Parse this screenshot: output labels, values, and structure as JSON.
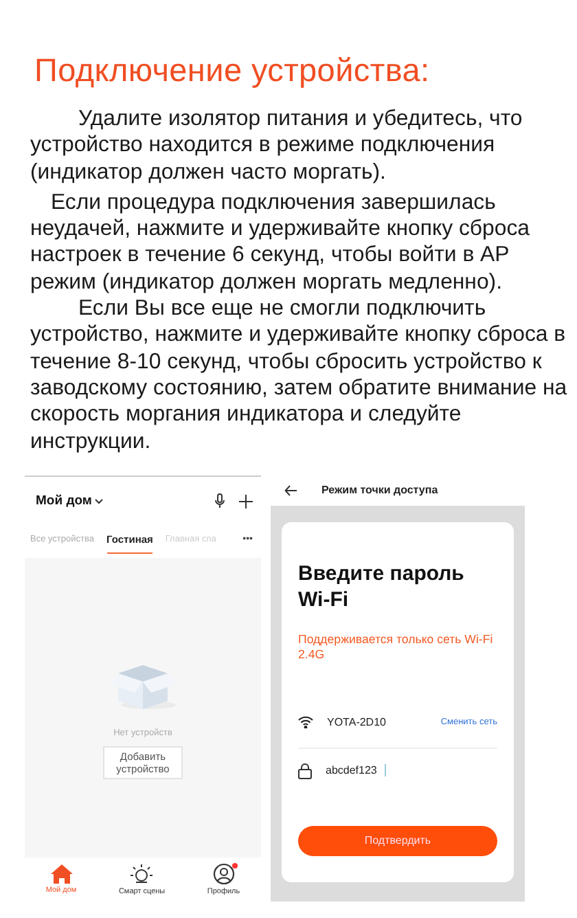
{
  "title": "Подключение устройства:",
  "paragraphs": [
    {
      "text": "Удалите изолятор питания и убедитесь, что устройство находится в режиме подключения (индикатор должен часто моргать).",
      "kind": "deep"
    },
    {
      "text": "Если процедура подключения завершилась неудачей, нажмите и удерживайте кнопку сброса настроек в течение 6 секунд, чтобы войти в AP режим (индикатор должен моргать медленно).",
      "kind": "shallow"
    },
    {
      "text": "Если Вы все еще не смогли подключить устройство, нажмите и удерживайте кнопку сброса в течение 8-10 секунд, чтобы сбросить устройство к заводскому состоянию, затем обратите внимание на скорость моргания индикатора и следуйте инструкции.",
      "kind": "deep"
    }
  ],
  "home_screen": {
    "home_name": "Мой дом",
    "tabs": [
      {
        "label": "Все устройства",
        "selected": false
      },
      {
        "label": "Гостиная",
        "selected": true
      },
      {
        "label": "Главная спа",
        "selected": false
      }
    ],
    "more": "•••",
    "empty_text": "Нет устройств",
    "add_button": "Добавить устройство",
    "nav": [
      {
        "label": "Мой дом",
        "kind": "home",
        "selected": true,
        "badge": false
      },
      {
        "label": "Смарт сцены",
        "kind": "scenes",
        "selected": false,
        "badge": false
      },
      {
        "label": "Профиль",
        "kind": "profile",
        "selected": false,
        "badge": true
      }
    ]
  },
  "ap_screen": {
    "header": "Режим точки доступа",
    "heading": "Введите пароль Wi-Fi",
    "note": "Поддерживается только сеть Wi-Fi 2.4G",
    "network": "YOTA-2D10",
    "change_link": "Сменить сеть",
    "password": "abcdef123",
    "confirm_button": "Подтвердить"
  }
}
